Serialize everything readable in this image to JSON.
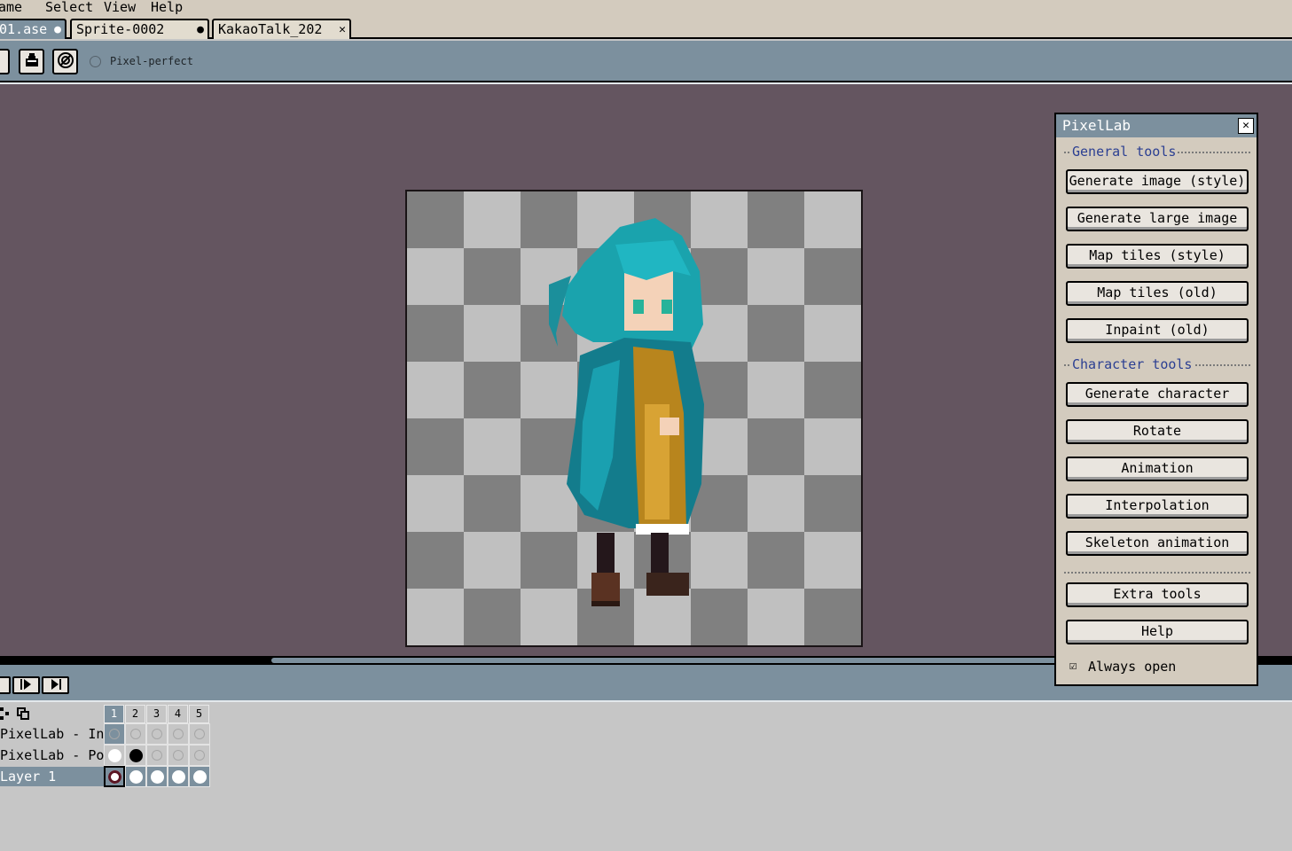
{
  "menu": {
    "items": [
      "ame",
      "Select",
      "View",
      "Help"
    ]
  },
  "tabs": [
    {
      "label": "01.ase",
      "mark": "●"
    },
    {
      "label": "Sprite-0002",
      "mark": "●"
    },
    {
      "label": "KakaoTalk_202",
      "mark": "✕"
    }
  ],
  "context_bar": {
    "pixel_perfect_label": "Pixel-perfect",
    "pixel_perfect_checked": false
  },
  "timeline": {
    "frames": [
      "1",
      "2",
      "3",
      "4",
      "5"
    ],
    "active_frame": "1",
    "layers": [
      {
        "name": "PixelLab - Inp",
        "cels": [
          "selected-empty",
          "empty",
          "empty",
          "empty",
          "empty"
        ]
      },
      {
        "name": "PixelLab - Pos",
        "cels": [
          "white",
          "black",
          "empty",
          "empty",
          "empty"
        ]
      },
      {
        "name": "Layer 1",
        "cels": [
          "white-selected",
          "white",
          "white",
          "white",
          "white"
        ]
      }
    ]
  },
  "pixellab": {
    "title": "PixelLab",
    "general_section": "General tools",
    "general_buttons": [
      "Generate image (style)",
      "Generate large image",
      "Map tiles (style)",
      "Map tiles (old)",
      "Inpaint (old)"
    ],
    "character_section": "Character tools",
    "character_buttons": [
      "Generate character",
      "Rotate",
      "Animation",
      "Interpolation",
      "Skeleton animation"
    ],
    "extra_buttons": [
      "Extra tools",
      "Help"
    ],
    "always_open_label": "Always open",
    "always_open_checked": true
  },
  "colors": {
    "workspace": "#645560",
    "chrome_blue": "#7c909e",
    "chrome_beige": "#d3cbbe",
    "section_text": "#2b3f92"
  }
}
